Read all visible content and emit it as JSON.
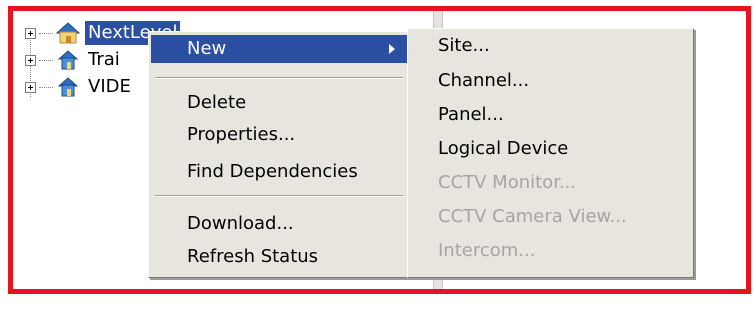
{
  "tree": {
    "nodes": [
      {
        "label": "NextLevel",
        "selected": true,
        "icon": "home-icon"
      },
      {
        "label": "Trai",
        "selected": false,
        "icon": "site-icon"
      },
      {
        "label": "VIDE",
        "selected": false,
        "icon": "site-icon"
      }
    ]
  },
  "context_menu": {
    "new_label": "New",
    "delete_label": "Delete",
    "properties_label": "Properties...",
    "find_dependencies_label": "Find Dependencies",
    "download_label": "Download...",
    "refresh_status_label": "Refresh Status"
  },
  "submenu": {
    "site_label": "Site...",
    "channel_label": "Channel...",
    "panel_label": "Panel...",
    "logical_device_label": "Logical Device",
    "cctv_monitor_label": "CCTV Monitor...",
    "cctv_camera_view_label": "CCTV Camera View...",
    "intercom_label": "Intercom..."
  },
  "colors": {
    "highlight": "#2b4fa3",
    "frame_border": "#e8141d",
    "menu_background": "#e8e5df",
    "disabled_text": "#a8a5a0"
  }
}
